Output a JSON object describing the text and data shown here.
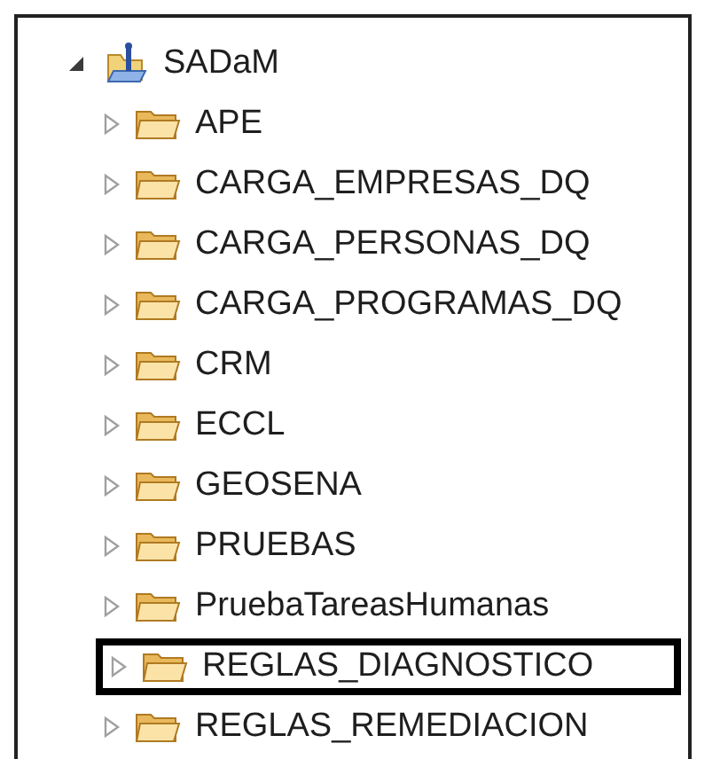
{
  "tree": {
    "label": "SADaM",
    "expanded": true,
    "children": [
      {
        "label": "APE",
        "highlighted": false
      },
      {
        "label": "CARGA_EMPRESAS_DQ",
        "highlighted": false
      },
      {
        "label": "CARGA_PERSONAS_DQ",
        "highlighted": false
      },
      {
        "label": "CARGA_PROGRAMAS_DQ",
        "highlighted": false
      },
      {
        "label": "CRM",
        "highlighted": false
      },
      {
        "label": "ECCL",
        "highlighted": false
      },
      {
        "label": "GEOSENA",
        "highlighted": false
      },
      {
        "label": "PRUEBAS",
        "highlighted": false
      },
      {
        "label": "PruebaTareasHumanas",
        "highlighted": false
      },
      {
        "label": "REGLAS_DIAGNOSTICO",
        "highlighted": true
      },
      {
        "label": "REGLAS_REMEDIACION",
        "highlighted": false
      }
    ]
  }
}
